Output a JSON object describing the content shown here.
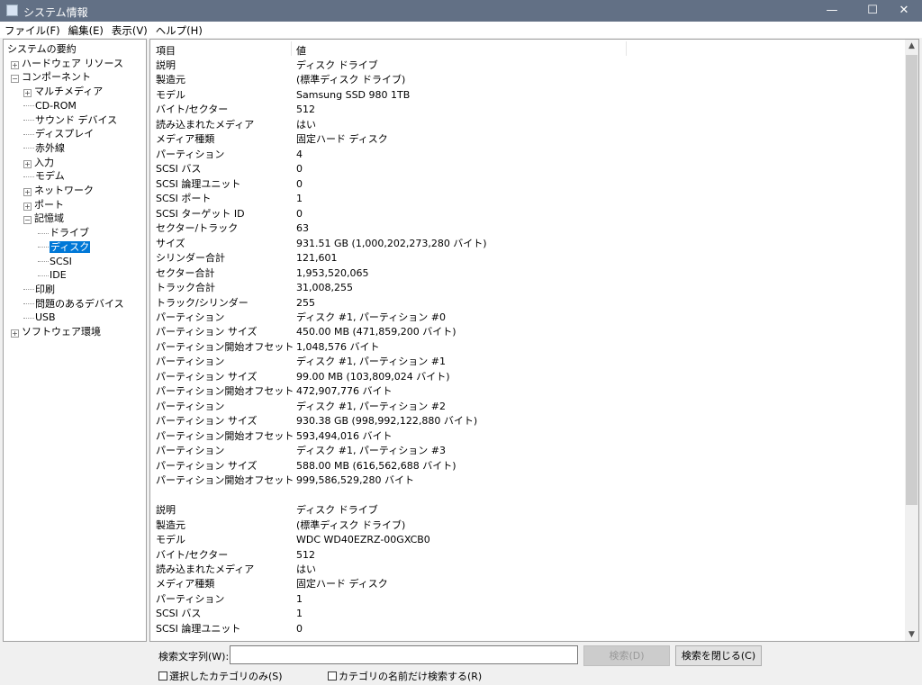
{
  "window": {
    "title": "システム情報",
    "minimize": "—",
    "maximize": "☐",
    "close": "✕"
  },
  "menu": [
    "ファイル(F)",
    "編集(E)",
    "表示(V)",
    "ヘルプ(H)"
  ],
  "tree": [
    {
      "label": "システムの要約",
      "level": 0,
      "expander": ""
    },
    {
      "label": "ハードウェア リソース",
      "level": 1,
      "expander": "+"
    },
    {
      "label": "コンポーネント",
      "level": 1,
      "expander": "-"
    },
    {
      "label": "マルチメディア",
      "level": 2,
      "expander": "+"
    },
    {
      "label": "CD-ROM",
      "level": 2,
      "expander": ""
    },
    {
      "label": "サウンド デバイス",
      "level": 2,
      "expander": ""
    },
    {
      "label": "ディスプレイ",
      "level": 2,
      "expander": ""
    },
    {
      "label": "赤外線",
      "level": 2,
      "expander": ""
    },
    {
      "label": "入力",
      "level": 2,
      "expander": "+"
    },
    {
      "label": "モデム",
      "level": 2,
      "expander": ""
    },
    {
      "label": "ネットワーク",
      "level": 2,
      "expander": "+"
    },
    {
      "label": "ポート",
      "level": 2,
      "expander": "+"
    },
    {
      "label": "記憶域",
      "level": 2,
      "expander": "-"
    },
    {
      "label": "ドライブ",
      "level": 3,
      "expander": ""
    },
    {
      "label": "ディスク",
      "level": 3,
      "expander": "",
      "selected": true
    },
    {
      "label": "SCSI",
      "level": 3,
      "expander": ""
    },
    {
      "label": "IDE",
      "level": 3,
      "expander": ""
    },
    {
      "label": "印刷",
      "level": 2,
      "expander": ""
    },
    {
      "label": "問題のあるデバイス",
      "level": 2,
      "expander": ""
    },
    {
      "label": "USB",
      "level": 2,
      "expander": ""
    },
    {
      "label": "ソフトウェア環境",
      "level": 1,
      "expander": "+"
    }
  ],
  "list": {
    "headers": [
      "項目",
      "値"
    ],
    "rows": [
      [
        "説明",
        "ディスク ドライブ"
      ],
      [
        "製造元",
        "(標準ディスク ドライブ)"
      ],
      [
        "モデル",
        "Samsung SSD 980 1TB"
      ],
      [
        "バイト/セクター",
        "512"
      ],
      [
        "読み込まれたメディア",
        "はい"
      ],
      [
        "メディア種類",
        "固定ハード ディスク"
      ],
      [
        "パーティション",
        "4"
      ],
      [
        "SCSI バス",
        "0"
      ],
      [
        "SCSI 論理ユニット",
        "0"
      ],
      [
        "SCSI ポート",
        "1"
      ],
      [
        "SCSI ターゲット ID",
        "0"
      ],
      [
        "セクター/トラック",
        "63"
      ],
      [
        "サイズ",
        "931.51 GB (1,000,202,273,280 バイト)"
      ],
      [
        "シリンダー合計",
        "121,601"
      ],
      [
        "セクター合計",
        "1,953,520,065"
      ],
      [
        "トラック合計",
        "31,008,255"
      ],
      [
        "トラック/シリンダー",
        "255"
      ],
      [
        "パーティション",
        "ディスク #1, パーティション #0"
      ],
      [
        "パーティション サイズ",
        "450.00 MB (471,859,200 バイト)"
      ],
      [
        "パーティション開始オフセット",
        "1,048,576 バイト"
      ],
      [
        "パーティション",
        "ディスク #1, パーティション #1"
      ],
      [
        "パーティション サイズ",
        "99.00 MB (103,809,024 バイト)"
      ],
      [
        "パーティション開始オフセット",
        "472,907,776 バイト"
      ],
      [
        "パーティション",
        "ディスク #1, パーティション #2"
      ],
      [
        "パーティション サイズ",
        "930.38 GB (998,992,122,880 バイト)"
      ],
      [
        "パーティション開始オフセット",
        "593,494,016 バイト"
      ],
      [
        "パーティション",
        "ディスク #1, パーティション #3"
      ],
      [
        "パーティション サイズ",
        "588.00 MB (616,562,688 バイト)"
      ],
      [
        "パーティション開始オフセット",
        "999,586,529,280 バイト"
      ],
      [
        "",
        ""
      ],
      [
        "説明",
        "ディスク ドライブ"
      ],
      [
        "製造元",
        "(標準ディスク ドライブ)"
      ],
      [
        "モデル",
        "WDC WD40EZRZ-00GXCB0"
      ],
      [
        "バイト/セクター",
        "512"
      ],
      [
        "読み込まれたメディア",
        "はい"
      ],
      [
        "メディア種類",
        "固定ハード ディスク"
      ],
      [
        "パーティション",
        "1"
      ],
      [
        "SCSI バス",
        "1"
      ],
      [
        "SCSI 論理ユニット",
        "0"
      ]
    ]
  },
  "search": {
    "label": "検索文字列(W):",
    "value": "",
    "find_button": "検索(D)",
    "close_button": "検索を閉じる(C)",
    "selected_only": "選択したカテゴリのみ(S)",
    "names_only": "カテゴリの名前だけ検索する(R)"
  },
  "colors": {
    "titlebar": "#627085",
    "selection": "#0078d7"
  }
}
